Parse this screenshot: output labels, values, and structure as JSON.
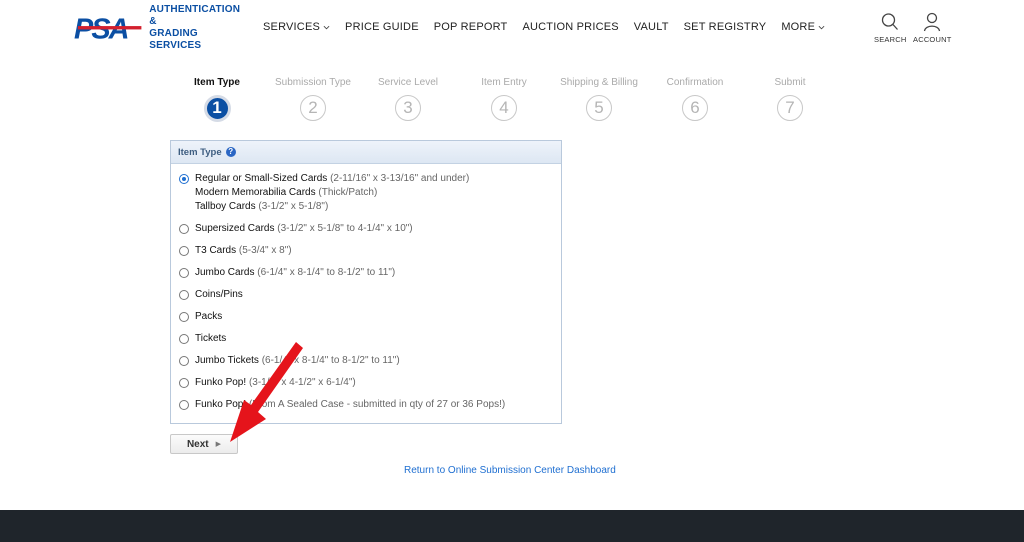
{
  "brand": {
    "logo_text": "PSA",
    "tagline_line1": "AUTHENTICATION &",
    "tagline_line2": "GRADING SERVICES",
    "color": "#0b4fa3",
    "accent": "#d3202e"
  },
  "nav": {
    "items": [
      {
        "label": "SERVICES",
        "has_caret": true
      },
      {
        "label": "PRICE GUIDE",
        "has_caret": false
      },
      {
        "label": "POP REPORT",
        "has_caret": false
      },
      {
        "label": "AUCTION PRICES",
        "has_caret": false
      },
      {
        "label": "VAULT",
        "has_caret": false
      },
      {
        "label": "SET REGISTRY",
        "has_caret": false
      },
      {
        "label": "MORE",
        "has_caret": true
      }
    ],
    "search_label": "SEARCH",
    "account_label": "ACCOUNT",
    "search_icon": "search-icon",
    "account_icon": "user-icon"
  },
  "steps": [
    {
      "label": "Item Type",
      "number": "1",
      "active": true
    },
    {
      "label": "Submission Type",
      "number": "2",
      "active": false
    },
    {
      "label": "Service Level",
      "number": "3",
      "active": false
    },
    {
      "label": "Item Entry",
      "number": "4",
      "active": false
    },
    {
      "label": "Shipping & Billing",
      "number": "5",
      "active": false
    },
    {
      "label": "Confirmation",
      "number": "6",
      "active": false
    },
    {
      "label": "Submit",
      "number": "7",
      "active": false
    }
  ],
  "panel": {
    "title": "Item Type",
    "help_icon": "?",
    "options": [
      {
        "lines": [
          {
            "name": "Regular or Small-Sized Cards",
            "dim": "(2-11/16\" x 3-13/16\" and under)"
          },
          {
            "name": "Modern Memorabilia Cards",
            "dim": "(Thick/Patch)"
          },
          {
            "name": "Tallboy Cards",
            "dim": "(3-1/2\" x 5-1/8\")"
          }
        ],
        "checked": true
      },
      {
        "lines": [
          {
            "name": "Supersized Cards",
            "dim": "(3-1/2\" x 5-1/8\" to 4-1/4\" x 10\")"
          }
        ],
        "checked": false
      },
      {
        "lines": [
          {
            "name": "T3 Cards",
            "dim": "(5-3/4\" x 8\")"
          }
        ],
        "checked": false
      },
      {
        "lines": [
          {
            "name": "Jumbo Cards",
            "dim": "(6-1/4\" x 8-1/4\" to 8-1/2\" to 11\")"
          }
        ],
        "checked": false
      },
      {
        "lines": [
          {
            "name": "Coins/Pins",
            "dim": ""
          }
        ],
        "checked": false
      },
      {
        "lines": [
          {
            "name": "Packs",
            "dim": ""
          }
        ],
        "checked": false
      },
      {
        "lines": [
          {
            "name": "Tickets",
            "dim": ""
          }
        ],
        "checked": false
      },
      {
        "lines": [
          {
            "name": "Jumbo Tickets",
            "dim": "(6-1/4\" x 8-1/4\" to 8-1/2\" to 11\")"
          }
        ],
        "checked": false
      },
      {
        "lines": [
          {
            "name": "Funko Pop!",
            "dim": "(3-1/2\" x 4-1/2\" x 6-1/4\")"
          }
        ],
        "checked": false
      },
      {
        "lines": [
          {
            "name": "Funko Pop!",
            "dim": "(From A Sealed Case - submitted in qty of 27 or 36 Pops!)"
          }
        ],
        "checked": false
      }
    ]
  },
  "actions": {
    "next_label": "Next",
    "next_arrow": "▶",
    "dashboard_link": "Return to Online Submission Center Dashboard"
  },
  "colors": {
    "link": "#1f6fd1",
    "active_step": "#0b4fa3",
    "footer": "#1f252b",
    "annotation": "#e5141b"
  }
}
